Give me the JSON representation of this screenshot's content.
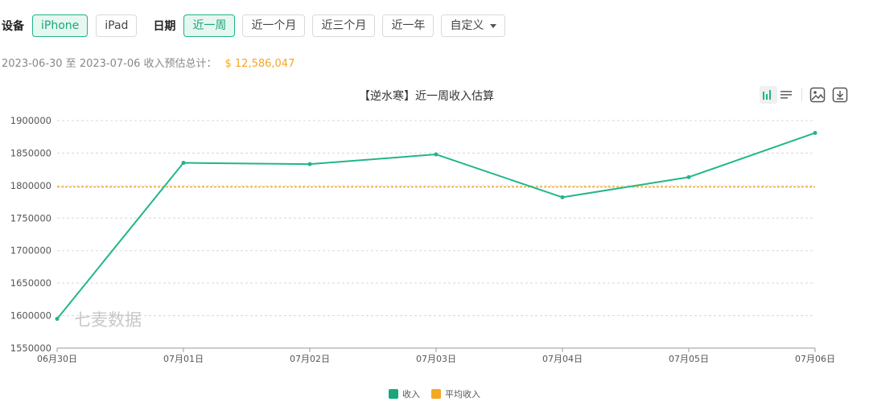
{
  "filters": {
    "device_label": "设备",
    "devices": [
      "iPhone",
      "iPad"
    ],
    "device_active": "iPhone",
    "date_label": "日期",
    "ranges": [
      "近一周",
      "近一个月",
      "近三个月",
      "近一年"
    ],
    "range_active": "近一周",
    "custom_label": "自定义"
  },
  "summary": {
    "text": "2023-06-30 至 2023-07-06 收入预估总计：",
    "total": "$ 12,586,047"
  },
  "watermark": "七麦数据",
  "colors": {
    "accent": "#1db48a",
    "revenue": "#22b58c",
    "average": "#f5a623"
  },
  "chart_data": {
    "type": "line",
    "title": "【逆水寒】近一周收入估算",
    "categories": [
      "06月30日",
      "07月01日",
      "07月02日",
      "07月03日",
      "07月04日",
      "07月05日",
      "07月06日"
    ],
    "series": [
      {
        "name": "收入",
        "values": [
          1595000,
          1835000,
          1833000,
          1848000,
          1782000,
          1813000,
          1881000
        ]
      },
      {
        "name": "平均收入",
        "values": [
          1798007,
          1798007,
          1798007,
          1798007,
          1798007,
          1798007,
          1798007
        ]
      }
    ],
    "ylim": [
      1550000,
      1900000
    ],
    "yticks": [
      1550000,
      1600000,
      1650000,
      1700000,
      1750000,
      1800000,
      1850000,
      1900000
    ],
    "grid": true,
    "legend_position": "bottom-center"
  }
}
